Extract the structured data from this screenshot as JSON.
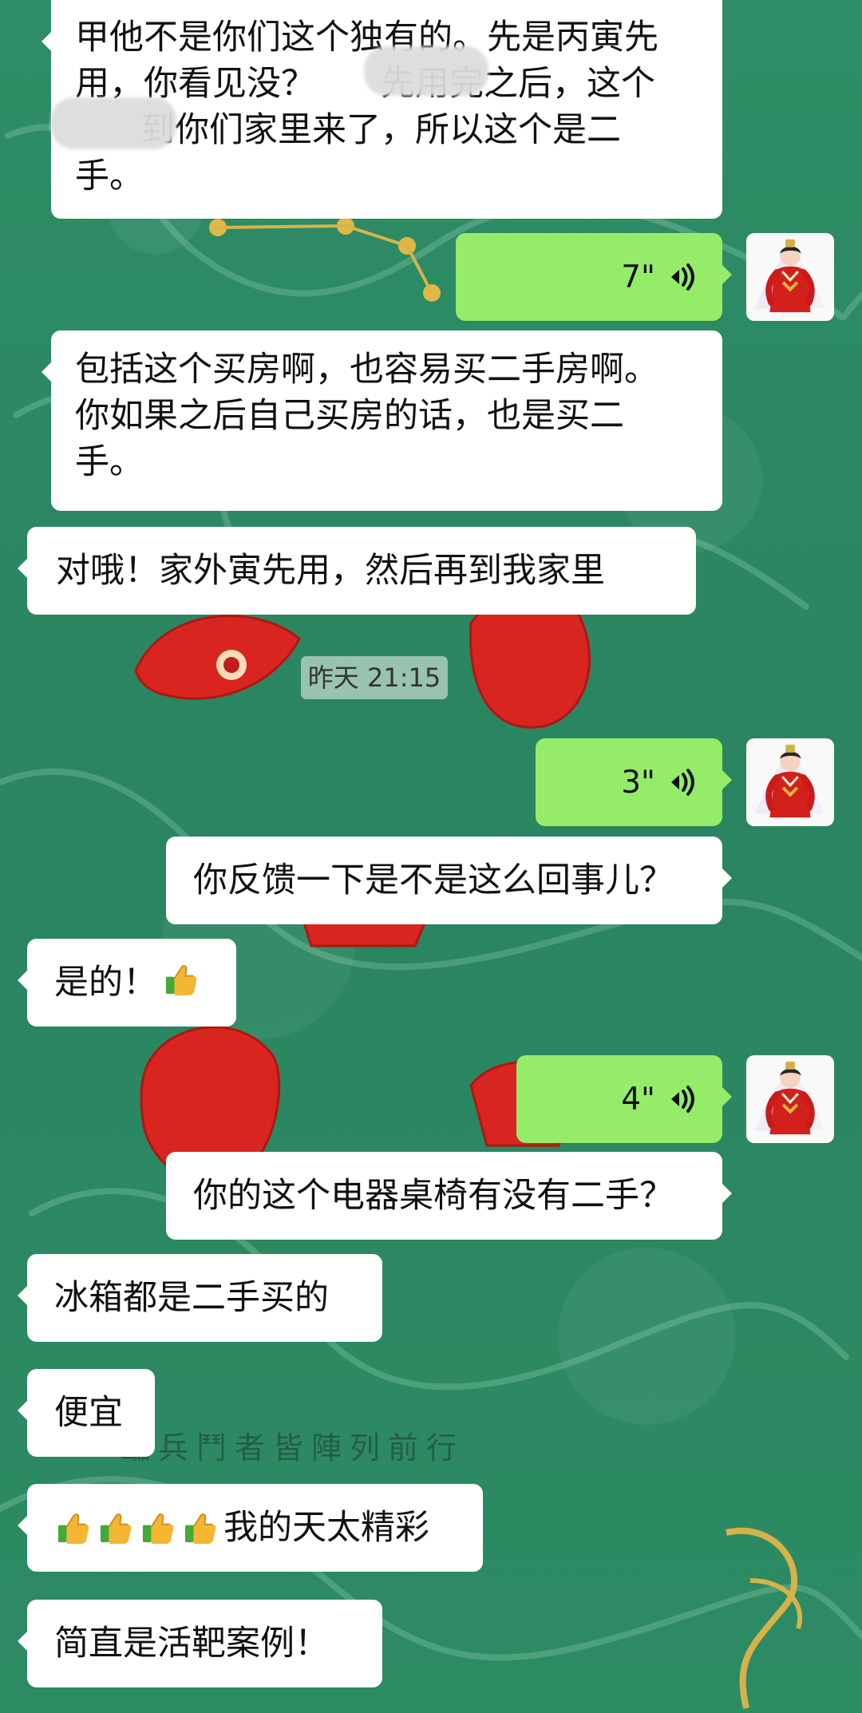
{
  "messages": {
    "m1_lines": "甲他不是你们这个独有的。先是丙寅先\n用，你看见没？      先用完之后，这个\n      到你们家里来了，所以这个是二\n手。",
    "voice_1_duration": "7\"",
    "m3_lines": "包括这个买房啊，也容易买二手房啊。\n你如果之后自己买房的话，也是买二\n手。",
    "m4": "对哦！家外寅先用，然后再到我家里",
    "timestamp": "昨天 21:15",
    "voice_2_duration": "3\"",
    "m6": "你反馈一下是不是这么回事儿？",
    "m7": "是的！",
    "voice_3_duration": "4\"",
    "m9": "你的这个电器桌椅有没有二手？",
    "m10": "冰箱都是二手买的",
    "m11": "便宜",
    "m12": "我的天太精彩",
    "m13": "简直是活靶案例！"
  },
  "background": {
    "watermark_text": "臨兵鬥者皆陣列前行"
  },
  "icons": {
    "voice": "voice-wave-icon",
    "thumb": "thumbs-up-icon",
    "avatar": "user-avatar"
  },
  "colors": {
    "chat_background": "#2f8f68",
    "incoming_bubble": "#ffffff",
    "outgoing_voice_bubble": "#95ec69",
    "decor_red": "#d8251f",
    "decor_gold": "#d8b44a"
  }
}
